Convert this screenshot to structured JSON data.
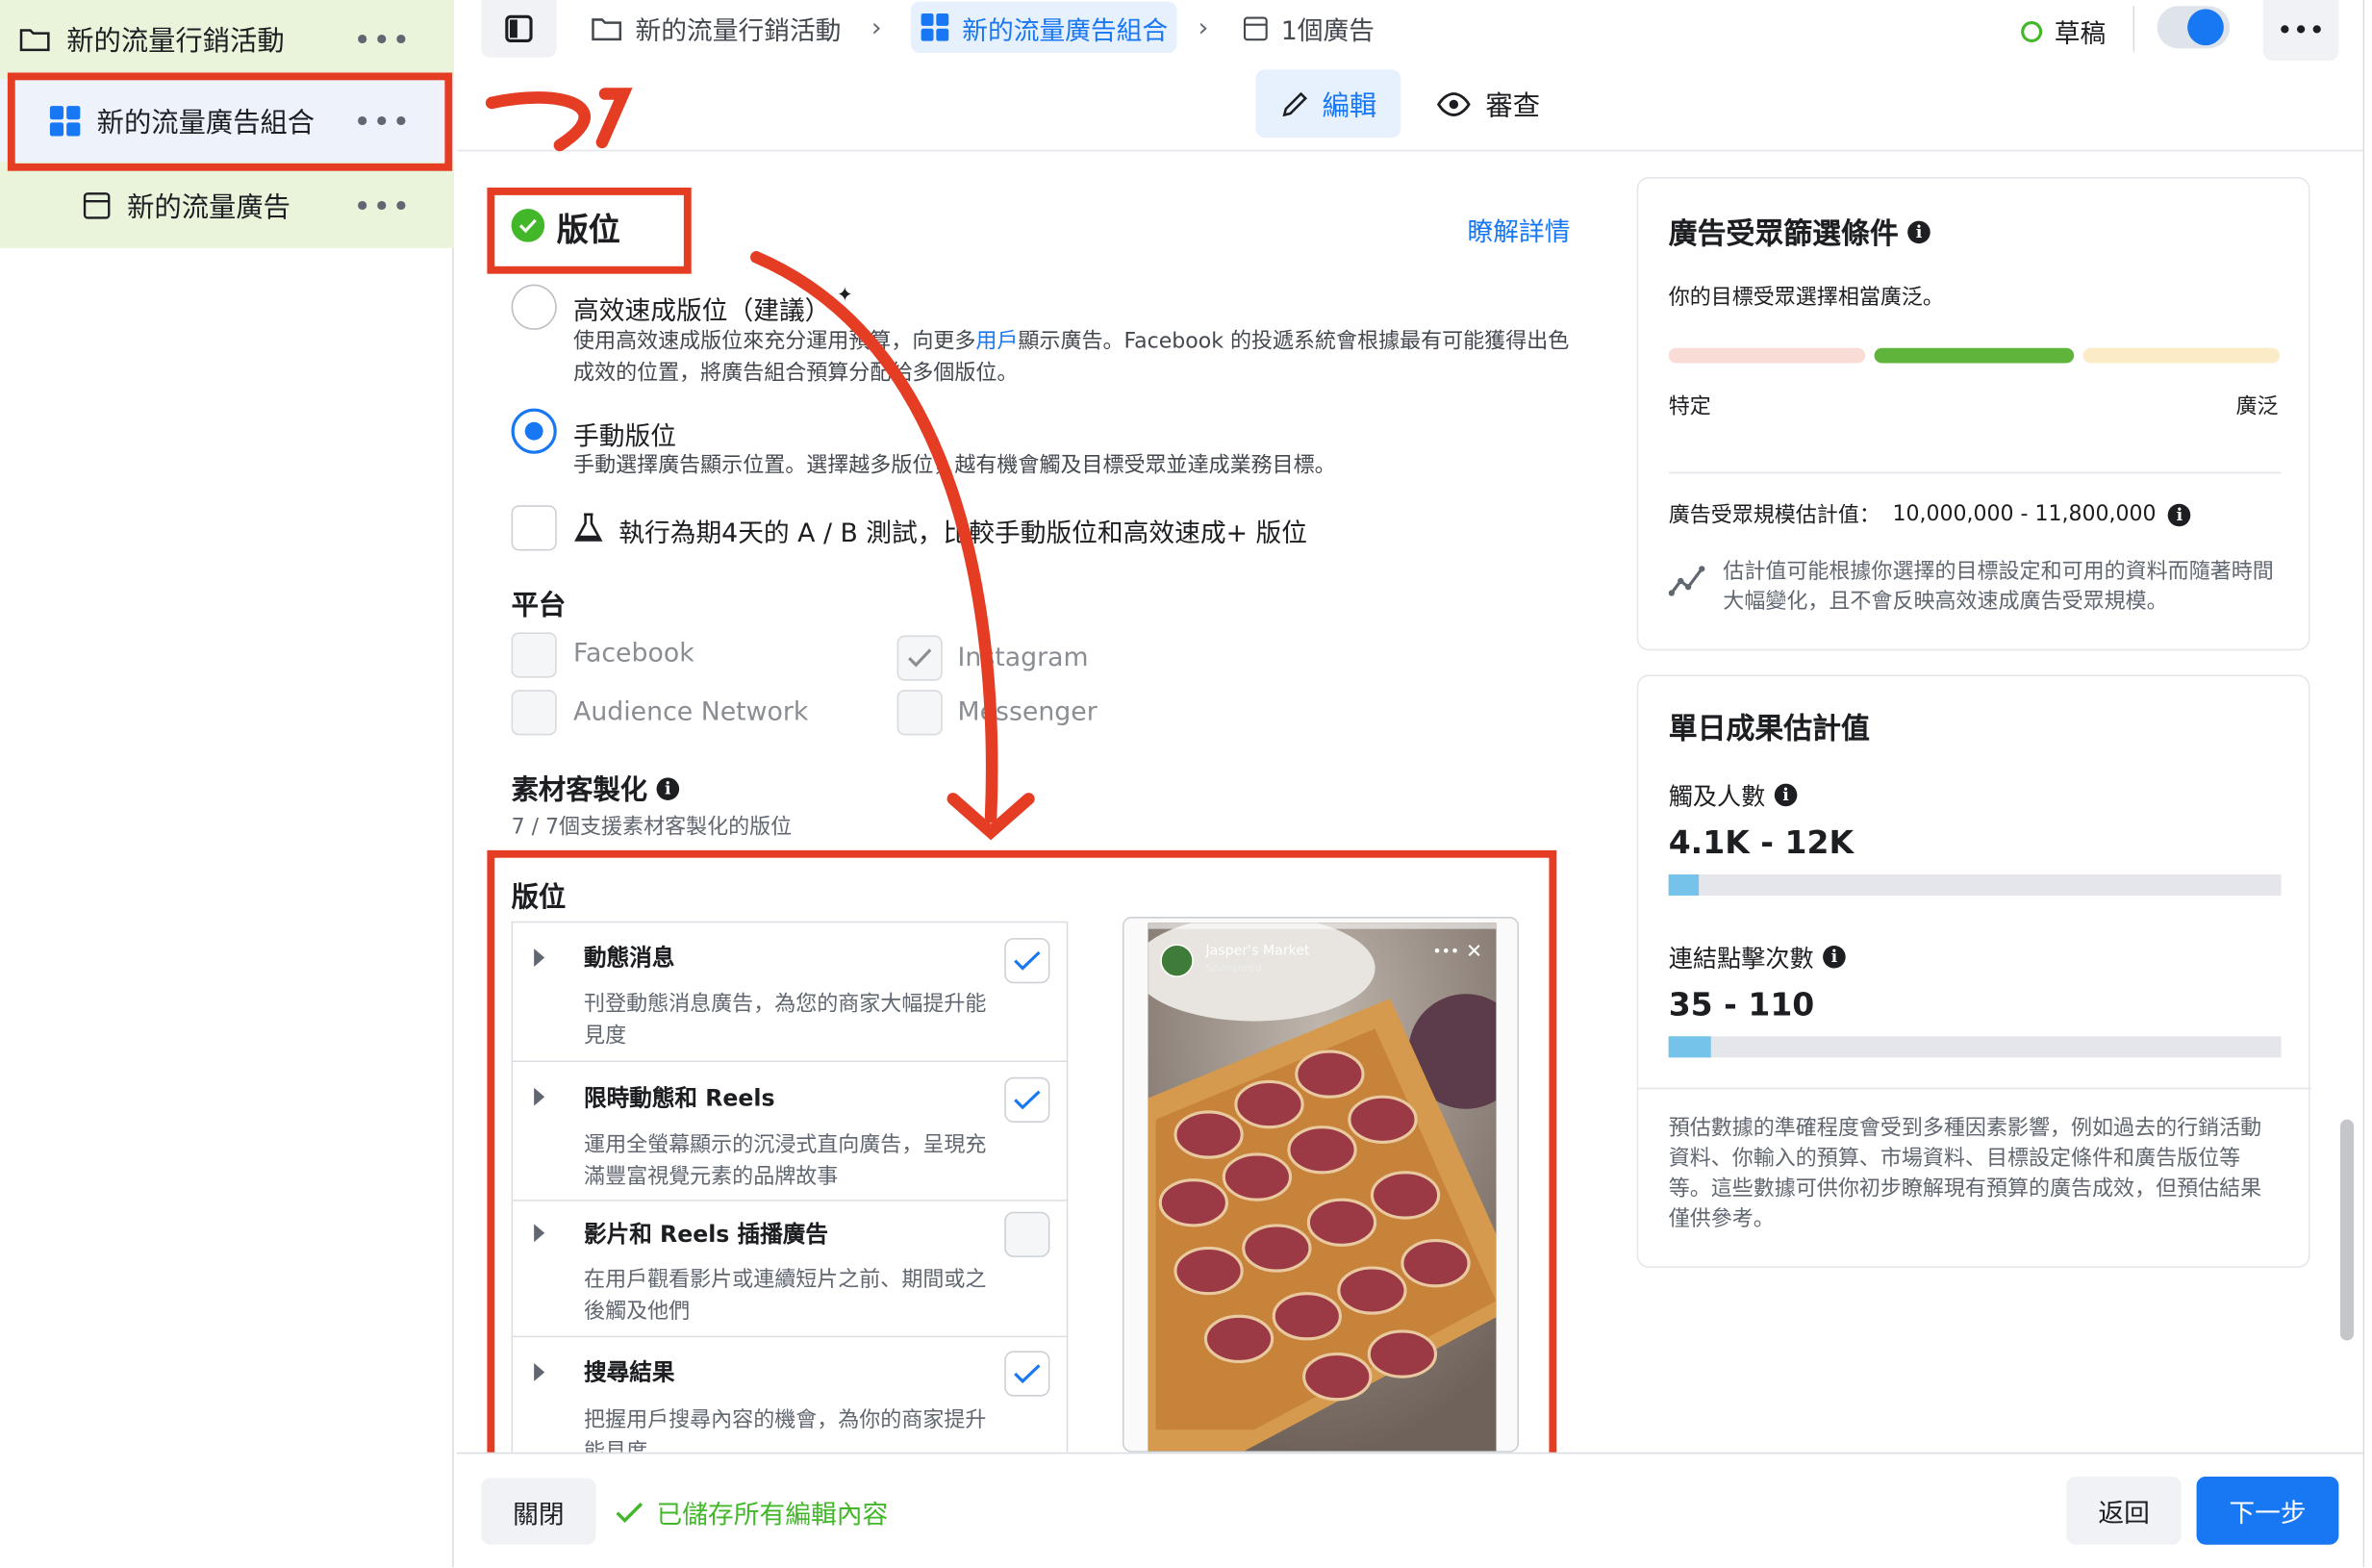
{
  "sidebar": {
    "campaign_label": "新的流量行銷活動",
    "adset_label": "新的流量廣告組合",
    "ad_label": "新的流量廣告",
    "more": "•••"
  },
  "breadcrumb": {
    "campaign": "新的流量行銷活動",
    "adset": "新的流量廣告組合",
    "ad": "1個廣告"
  },
  "status": {
    "label": "草稿",
    "more": "•••"
  },
  "tabs": {
    "edit": "編輯",
    "review": "審查"
  },
  "placements": {
    "title": "版位",
    "learn_more": "瞭解詳情",
    "advantage_title": "高效速成版位（建議）",
    "advantage_desc_1": "使用高效速成版位來充分運用預算，向更多",
    "advantage_desc_link": "用戶",
    "advantage_desc_2": "顯示廣告。Facebook 的投遞系統會根據最有可能獲得出色成效的位置，將廣告組合預算分配給多個版位。",
    "manual_title": "手動版位",
    "manual_desc": "手動選擇廣告顯示位置。選擇越多版位，越有機會觸及目標受眾並達成業務目標。",
    "ab_test": "執行為期4天的 A / B 測試，比較手動版位和高效速成+ 版位",
    "platform_title": "平台",
    "platforms": [
      "Facebook",
      "Instagram",
      "Audience Network",
      "Messenger"
    ],
    "customization_title": "素材客製化",
    "customization_count": "7 / 7個支援素材客製化的版位",
    "list_title": "版位",
    "items": [
      {
        "title": "動態消息",
        "desc": "刊登動態消息廣告，為您的商家大幅提升能見度",
        "checked": true
      },
      {
        "title": "限時動態和 Reels",
        "desc": "運用全螢幕顯示的沉浸式直向廣告，呈現充滿豐富視覺元素的品牌故事",
        "checked": true
      },
      {
        "title": "影片和 Reels 插播廣告",
        "desc": "在用戶觀看影片或連續短片之前、期間或之後觸及他們",
        "checked": false
      },
      {
        "title": "搜尋結果",
        "desc": "把握用戶搜尋內容的機會，為你的商家提升能見度",
        "checked": true
      }
    ],
    "preview_name": "Jasper's Market",
    "preview_sponsored": "Sponsored"
  },
  "audience": {
    "title": "廣告受眾篩選條件",
    "summary": "你的目標受眾選擇相當廣泛。",
    "left_label": "特定",
    "right_label": "廣泛",
    "size_label": "廣告受眾規模估計值：",
    "size_value": "10,000,000 - 11,800,000",
    "note": "估計值可能根據你選擇的目標設定和可用的資料而隨著時間大幅變化，且不會反映高效速成廣告受眾規模。"
  },
  "daily": {
    "title": "單日成果估計值",
    "reach_label": "觸及人數",
    "reach_value": "4.1K - 12K",
    "reach_level": 0.05,
    "clicks_label": "連結點擊次數",
    "clicks_value": "35 - 110",
    "clicks_level": 0.07,
    "disclaimer": "預估數據的準確程度會受到多種因素影響，例如過去的行銷活動資料、你輸入的預算、市場資料、目標設定條件和廣告版位等等。這些數據可供你初步瞭解現有預算的廣告成效，但預估結果僅供參考。"
  },
  "footer": {
    "close": "關閉",
    "saved": "已儲存所有編輯內容",
    "back": "返回",
    "next": "下一步"
  },
  "colors": {
    "annotation_red": "#e53c24",
    "primary_blue": "#1877f2",
    "success_green": "#42b72a",
    "sidebar_highlight": "#eaf4da"
  }
}
